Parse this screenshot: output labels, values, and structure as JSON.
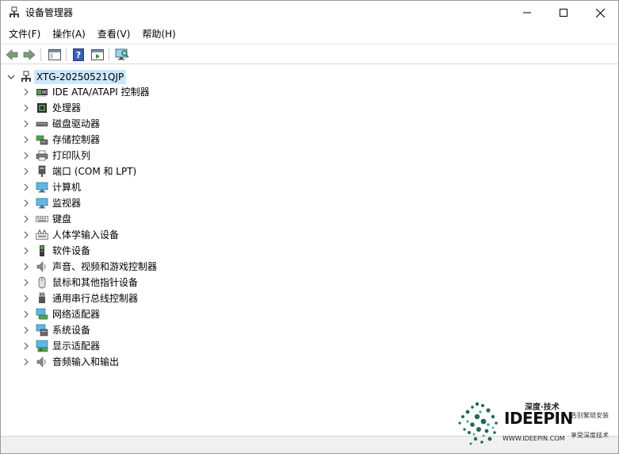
{
  "window": {
    "title": "设备管理器"
  },
  "menu": {
    "items": [
      "文件(F)",
      "操作(A)",
      "查看(V)",
      "帮助(H)"
    ]
  },
  "tree": {
    "root": "XTG-20250521QJP",
    "categories": [
      {
        "label": "IDE ATA/ATAPI 控制器",
        "icon": "ide-controller-icon"
      },
      {
        "label": "处理器",
        "icon": "processor-icon"
      },
      {
        "label": "磁盘驱动器",
        "icon": "disk-drive-icon"
      },
      {
        "label": "存储控制器",
        "icon": "storage-controller-icon"
      },
      {
        "label": "打印队列",
        "icon": "printer-icon"
      },
      {
        "label": "端口 (COM 和 LPT)",
        "icon": "port-icon"
      },
      {
        "label": "计算机",
        "icon": "computer-icon"
      },
      {
        "label": "监视器",
        "icon": "monitor-icon"
      },
      {
        "label": "键盘",
        "icon": "keyboard-icon"
      },
      {
        "label": "人体学输入设备",
        "icon": "hid-icon"
      },
      {
        "label": "软件设备",
        "icon": "software-device-icon"
      },
      {
        "label": "声音、视频和游戏控制器",
        "icon": "sound-icon"
      },
      {
        "label": "鼠标和其他指针设备",
        "icon": "mouse-icon"
      },
      {
        "label": "通用串行总线控制器",
        "icon": "usb-icon"
      },
      {
        "label": "网络适配器",
        "icon": "network-adapter-icon"
      },
      {
        "label": "系统设备",
        "icon": "system-device-icon"
      },
      {
        "label": "显示适配器",
        "icon": "display-adapter-icon"
      },
      {
        "label": "音频输入和输出",
        "icon": "audio-io-icon"
      }
    ]
  },
  "watermark": {
    "tagline": "深度·技术",
    "brand": "IDEEPIN",
    "url": "WWW.IDEEPIN.COM",
    "side_top": "告别繁琐安装",
    "side_bottom": "享受深度技术"
  },
  "colors": {
    "selection": "#cce8ff",
    "accent": "#0078d7",
    "brand_green": "#1f6b4f"
  }
}
